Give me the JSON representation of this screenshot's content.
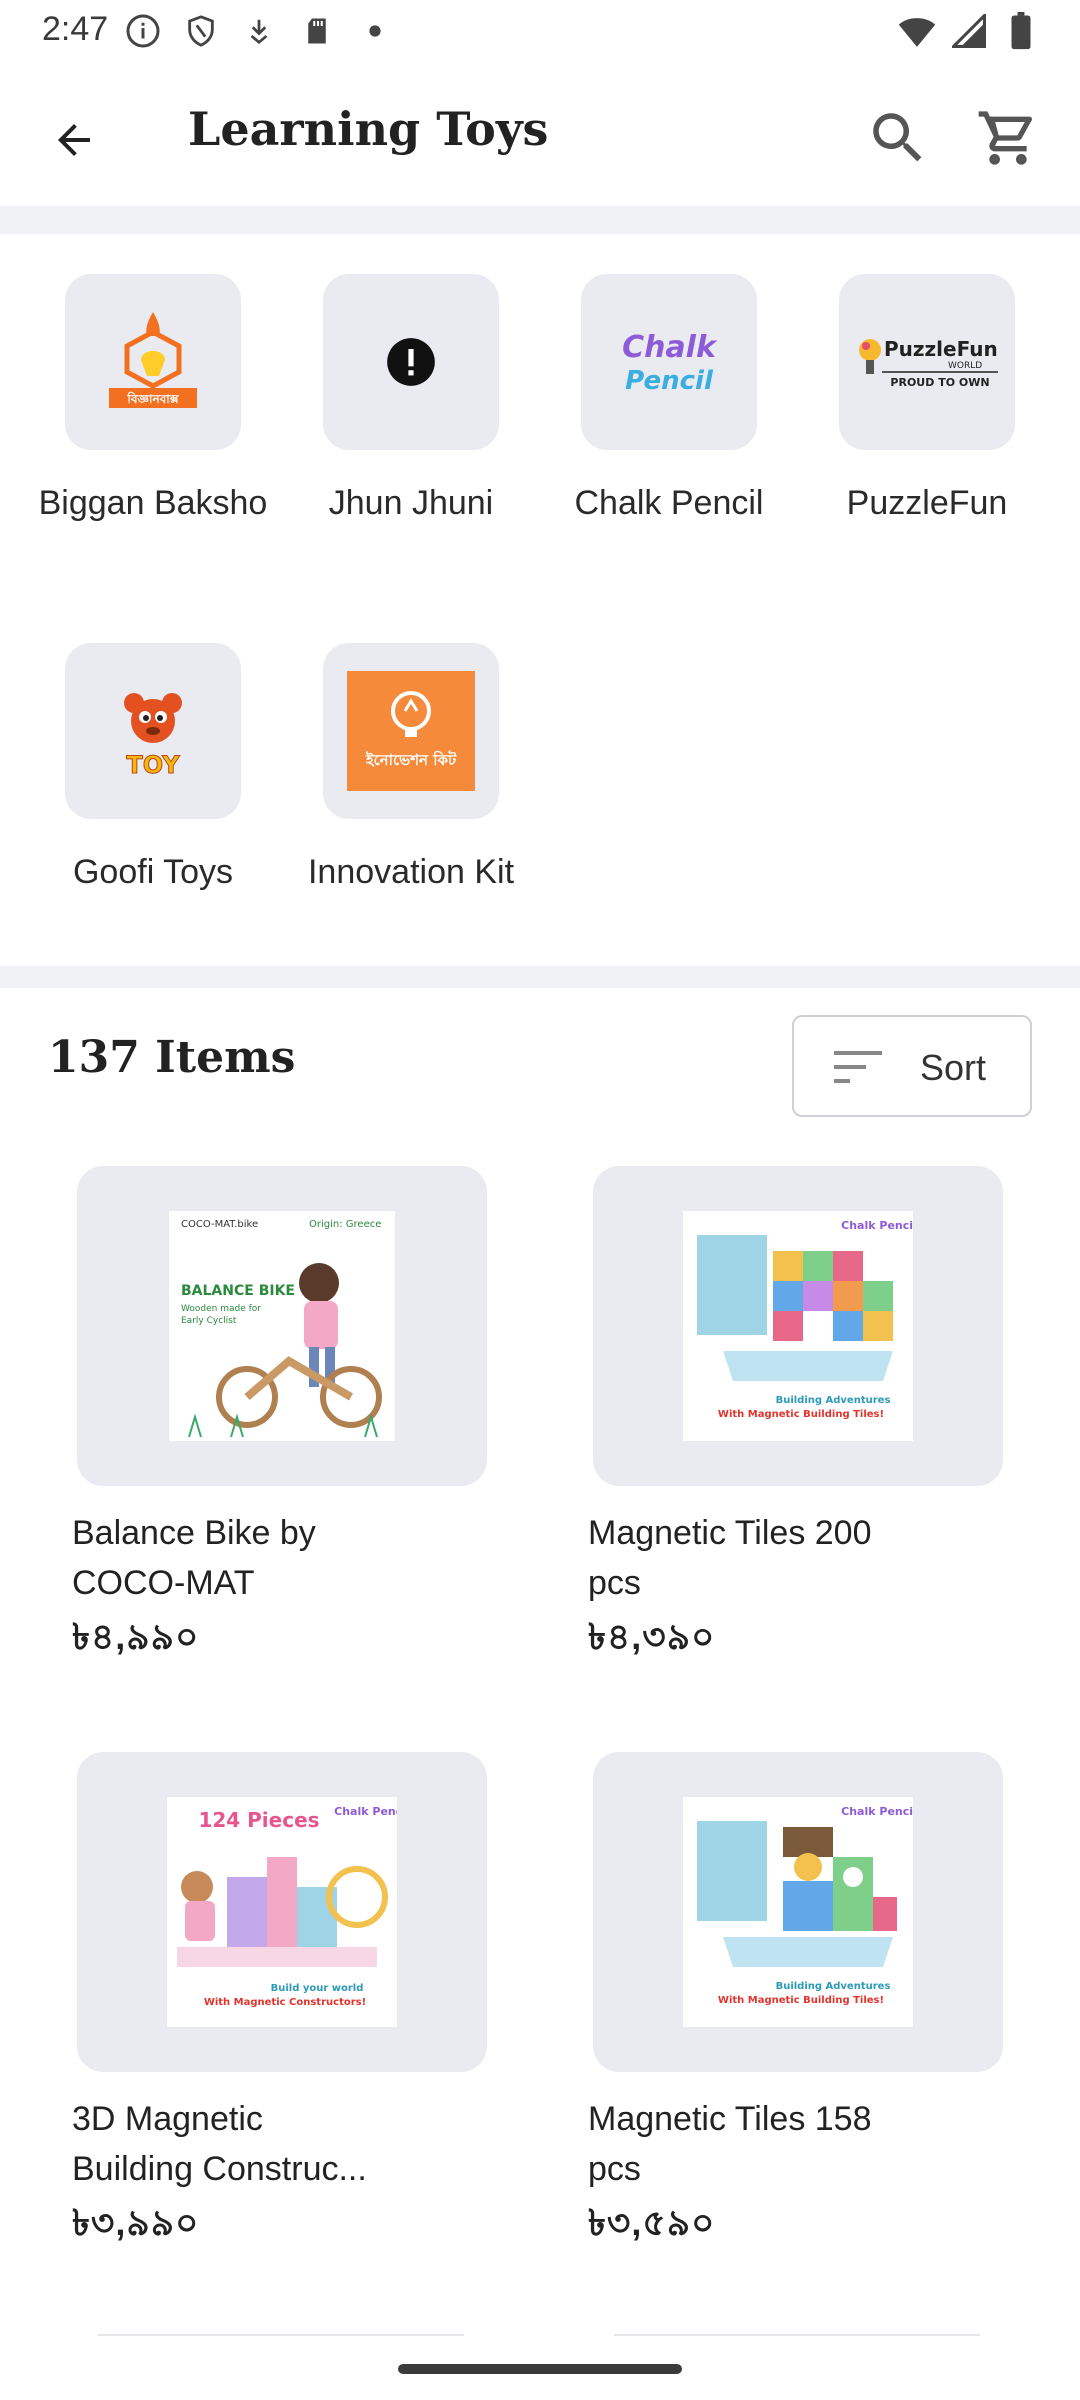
{
  "status_bar": {
    "time": "2:47"
  },
  "header": {
    "title": "Learning Toys"
  },
  "brands": [
    {
      "label": "Biggan Baksho",
      "logo_text": "বিজ্ঞানবাক্স"
    },
    {
      "label": "Jhun Jhuni"
    },
    {
      "label": "Chalk Pencil",
      "logo_text": "Chalk Pencil"
    },
    {
      "label": "PuzzleFun",
      "logo_text": "PuzzleFun",
      "logo_sub": "WORLD",
      "logo_tag": "PROUD TO OWN"
    },
    {
      "label": "Goofi Toys",
      "logo_text": "TOY"
    },
    {
      "label": "Innovation Kit",
      "logo_text": "ইনোভেশন কিট"
    }
  ],
  "items": {
    "count_label": "137 Items",
    "sort_label": "Sort"
  },
  "products": [
    {
      "name": "Balance Bike by COCO-MAT",
      "price": "৳৪,৯৯০",
      "image_text": {
        "brand": "COCO-MAT.bike",
        "origin": "Origin: Greece",
        "headline": "BALANCE BIKE",
        "sub": "Wooden made for Early Cyclist"
      }
    },
    {
      "name": "Magnetic Tiles 200 pcs",
      "price": "৳৪,৩৯০",
      "image_text": {
        "brand": "Chalk Pencil",
        "line1": "Building Adventures",
        "line2": "With Magnetic Building Tiles!"
      }
    },
    {
      "name": "3D Magnetic Building Construc...",
      "price": "৳৩,৯৯০",
      "image_text": {
        "brand": "Chalk Pencil",
        "badge": "124 Pieces",
        "line1": "Build your world",
        "line2": "With Magnetic Constructors!"
      }
    },
    {
      "name": "Magnetic Tiles 158 pcs",
      "price": "৳৩,৫৯০",
      "image_text": {
        "brand": "Chalk Pencil",
        "line1": "Building Adventures",
        "line2": "With Magnetic Building Tiles!"
      }
    }
  ],
  "colors": {
    "tile_bg": "#e9ebf1",
    "band": "#f1f2f5",
    "biggan_orange": "#f37021",
    "innovation_orange": "#f58a3b"
  }
}
